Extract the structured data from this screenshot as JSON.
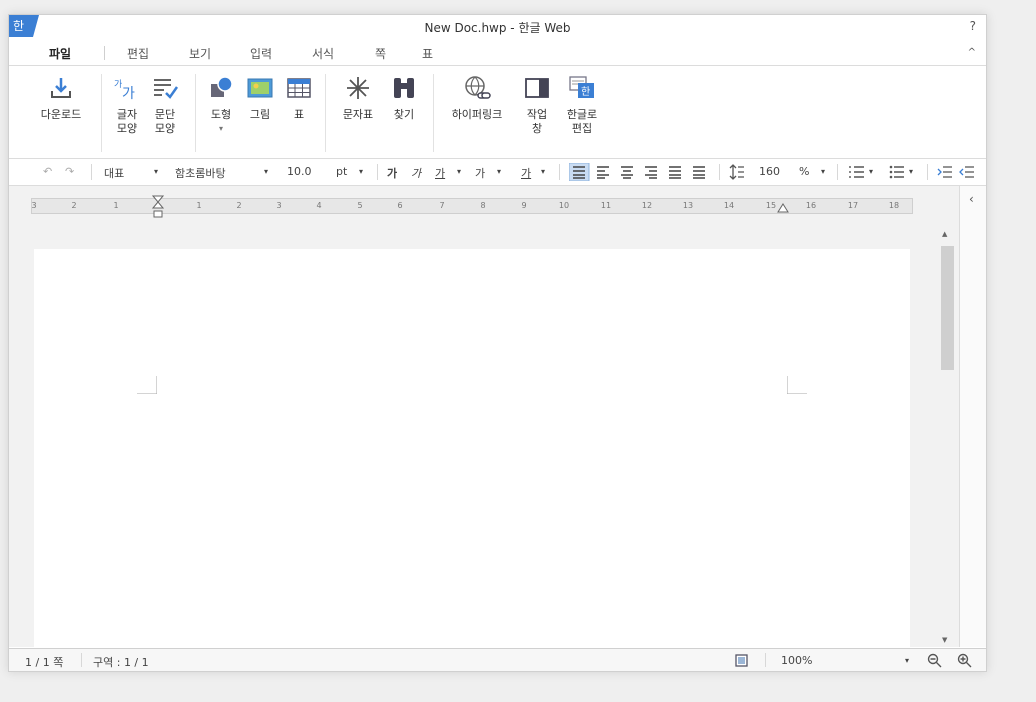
{
  "window": {
    "app_logo": "한",
    "title": "New Doc.hwp - 한글 Web",
    "help": "?"
  },
  "menu": {
    "items": [
      "파일",
      "편집",
      "보기",
      "입력",
      "서식",
      "쪽",
      "표"
    ],
    "collapse": "^"
  },
  "ribbon": {
    "buttons": [
      {
        "label": "다운로드",
        "icon": "download-icon"
      },
      {
        "label": "글자\n모양",
        "icon": "char-shape-icon"
      },
      {
        "label": "문단\n모양",
        "icon": "paragraph-shape-icon"
      },
      {
        "label": "도형",
        "icon": "shape-icon"
      },
      {
        "label": "그림",
        "icon": "picture-icon"
      },
      {
        "label": "표",
        "icon": "table-icon"
      },
      {
        "label": "문자표",
        "icon": "symbol-icon"
      },
      {
        "label": "찾기",
        "icon": "binoculars-icon"
      },
      {
        "label": "하이퍼링크",
        "icon": "hyperlink-icon"
      },
      {
        "label": "작업\n창",
        "icon": "task-pane-icon"
      },
      {
        "label": "한글로\n편집",
        "icon": "edit-in-hangul-icon"
      }
    ],
    "shape_dropdown": "▾"
  },
  "format": {
    "undo": "↶",
    "redo": "↷",
    "style": "대표",
    "font": "함초롬바탕",
    "size": "10.0",
    "size_unit": "pt",
    "bold": "가",
    "italic": "가",
    "underline": "가",
    "font_color": "가",
    "highlight": "가",
    "line_spacing": "160",
    "line_spacing_unit": "%",
    "dropdown": "▾"
  },
  "ruler": {
    "ticks": [
      "3",
      "2",
      "1",
      "1",
      "2",
      "3",
      "4",
      "5",
      "6",
      "7",
      "8",
      "9",
      "10",
      "11",
      "12",
      "13",
      "14",
      "15",
      "16",
      "17",
      "18"
    ]
  },
  "scroll": {
    "up": "▲",
    "down": "▼"
  },
  "side_panel": {
    "toggle": "‹"
  },
  "status": {
    "page": "1 / 1 쪽",
    "section": "구역 : 1 / 1",
    "zoom": "100%",
    "zoom_dropdown": "▾"
  },
  "colors": {
    "accent": "#3b7fd4",
    "align_active": "#c9dcf3"
  }
}
